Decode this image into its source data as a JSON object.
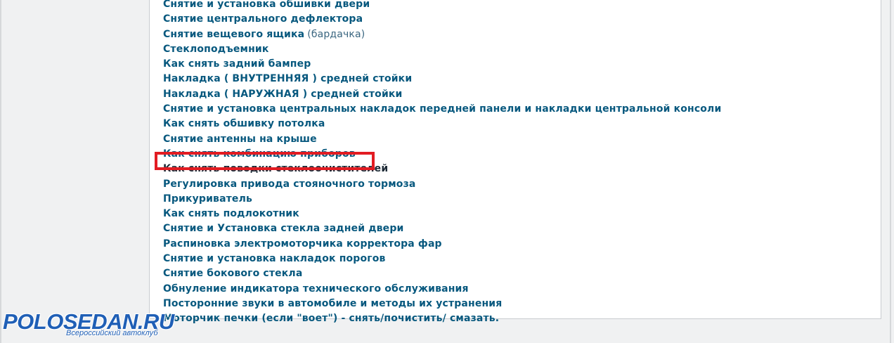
{
  "articles": {
    "items": [
      {
        "label": "Снятие и установка обшивки двери",
        "note": ""
      },
      {
        "label": "Снятие центрального дефлектора",
        "note": ""
      },
      {
        "label": "Снятие вещевого ящика",
        "note": "(бардачка)"
      },
      {
        "label": "Стеклоподъемник",
        "note": ""
      },
      {
        "label": "Как снять задний бампер",
        "note": ""
      },
      {
        "label": "Накладка ( ВНУТРЕННЯЯ ) средней стойки",
        "note": ""
      },
      {
        "label": "Накладка ( НАРУЖНАЯ ) средней стойки",
        "note": ""
      },
      {
        "label": "Снятие и установка центральных накладок передней панели и накладки центральной консоли",
        "note": ""
      },
      {
        "label": "Как снять обшивку потолка",
        "note": ""
      },
      {
        "label": "Снятие антенны на крыше",
        "note": ""
      },
      {
        "label": "Как снять комбинацию приборов",
        "note": ""
      },
      {
        "label": "Как снять поводки стеклоочистителей",
        "note": ""
      },
      {
        "label": "Регулировка привода стояночного тормоза",
        "note": ""
      },
      {
        "label": "Прикуриватель",
        "note": ""
      },
      {
        "label": "Как снять подлокотник",
        "note": ""
      },
      {
        "label": "Снятие и Установка стекла задней двери",
        "note": ""
      },
      {
        "label": "Распиновка электромоторчика корректора фар",
        "note": ""
      },
      {
        "label": "Снятие и установка накладок порогов",
        "note": ""
      },
      {
        "label": "Снятие бокового стекла",
        "note": ""
      },
      {
        "label": "Обнуление индикатора технического обслуживания",
        "note": ""
      },
      {
        "label": "Посторонние звуки в автомобиле и методы их устранения",
        "note": ""
      },
      {
        "label": "Моторчик печки (если \"воет\") - снять/почистить/ смазать.",
        "note": ""
      }
    ],
    "highlighted_index": 11
  },
  "watermark": {
    "brand": "POLOSEDAN.RU",
    "tagline": "Всероссийский автоклуб"
  },
  "colors": {
    "link": "#07587e",
    "highlight_border": "#e21c22",
    "panel_background": "#ffffff",
    "page_background": "#f0f1f2",
    "brand": "#1f5fb6"
  }
}
